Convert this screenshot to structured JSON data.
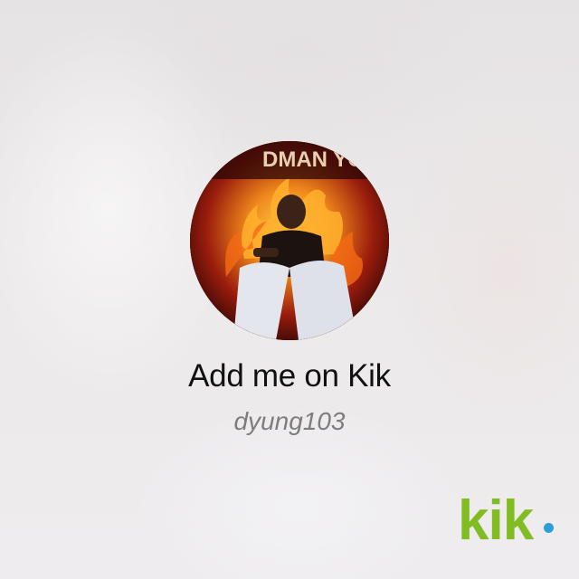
{
  "profile": {
    "avatar_label": "profile-photo",
    "avatar_banner": "DMAN YO",
    "title": "Add me on Kik",
    "username": "dyung103"
  },
  "logo": {
    "text": "kik",
    "brand_color": "#82bc23",
    "dot_color": "#2a9fd8"
  },
  "colors": {
    "background": "#ebe9ea",
    "title": "#111111",
    "username": "#7d7d7d"
  }
}
